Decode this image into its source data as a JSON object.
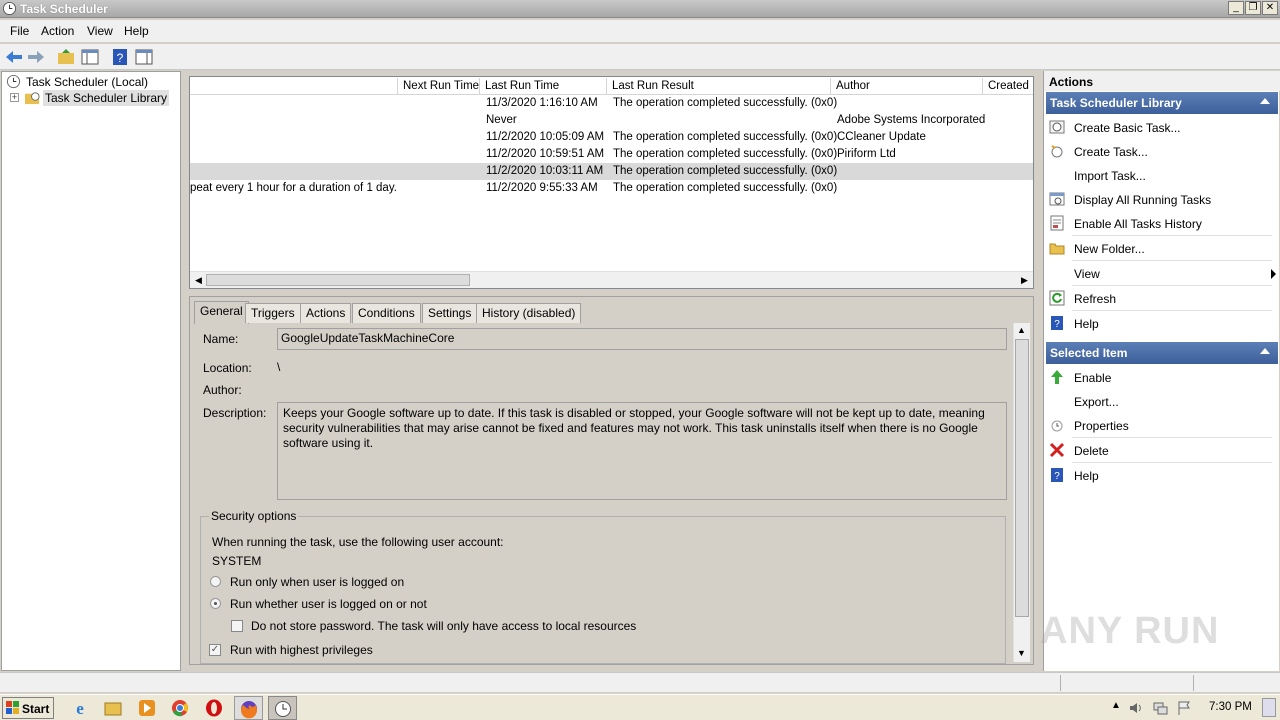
{
  "window": {
    "title": "Task Scheduler"
  },
  "menu": [
    "File",
    "Action",
    "View",
    "Help"
  ],
  "tree": {
    "root": "Task Scheduler (Local)",
    "library": "Task Scheduler Library"
  },
  "task_list": {
    "columns": [
      "Next Run Time",
      "Last Run Time",
      "Last Run Result",
      "Author",
      "Created"
    ],
    "rows": [
      {
        "trigger": "",
        "last_run": "11/3/2020 1:16:10 AM",
        "result": "The operation completed successfully. (0x0)",
        "author": ""
      },
      {
        "trigger": "",
        "last_run": "Never",
        "result": "",
        "author": "Adobe Systems Incorporated"
      },
      {
        "trigger": "",
        "last_run": "11/2/2020 10:05:09 AM",
        "result": "The operation completed successfully. (0x0)",
        "author": "CCleaner Update"
      },
      {
        "trigger": "",
        "last_run": "11/2/2020 10:59:51 AM",
        "result": "The operation completed successfully. (0x0)",
        "author": "Piriform Ltd"
      },
      {
        "trigger": "",
        "last_run": "11/2/2020 10:03:11 AM",
        "result": "The operation completed successfully. (0x0)",
        "author": ""
      },
      {
        "trigger": "peat every 1 hour for a duration of 1 day.",
        "last_run": "11/2/2020 9:55:33 AM",
        "result": "The operation completed successfully. (0x0)",
        "author": ""
      }
    ]
  },
  "details": {
    "tabs": [
      "General",
      "Triggers",
      "Actions",
      "Conditions",
      "Settings",
      "History (disabled)"
    ],
    "name_label": "Name:",
    "name_value": "GoogleUpdateTaskMachineCore",
    "location_label": "Location:",
    "location_value": "\\",
    "author_label": "Author:",
    "description_label": "Description:",
    "description_value": "Keeps your Google software up to date. If this task is disabled or stopped, your Google software will not be kept up to date, meaning security vulnerabilities that may arise cannot be fixed and features may not work. This task uninstalls itself when there is no Google software using it.",
    "security": {
      "title": "Security options",
      "account_prompt": "When running the task, use the following user account:",
      "account": "SYSTEM",
      "radio_logged_on": "Run only when user is logged on",
      "radio_whether": "Run whether user is logged on or not",
      "no_store_password": "Do not store password.  The task will only have access to local resources",
      "highest_privileges": "Run with highest privileges"
    }
  },
  "actions_pane": {
    "title": "Actions",
    "library_section": "Task Scheduler Library",
    "library_items": [
      "Create Basic Task...",
      "Create Task...",
      "Import Task...",
      "Display All Running Tasks",
      "Enable All Tasks History",
      "New Folder...",
      "View",
      "Refresh",
      "Help"
    ],
    "selected_section": "Selected Item",
    "selected_items": [
      "Enable",
      "Export...",
      "Properties",
      "Delete",
      "Help"
    ]
  },
  "taskbar": {
    "start": "Start",
    "clock": "7:30 PM"
  },
  "watermark": "ANY RUN",
  "colors": {
    "section_header": "#4a6ea9",
    "delete_icon": "#d22020",
    "help_icon": "#2a56b8"
  }
}
